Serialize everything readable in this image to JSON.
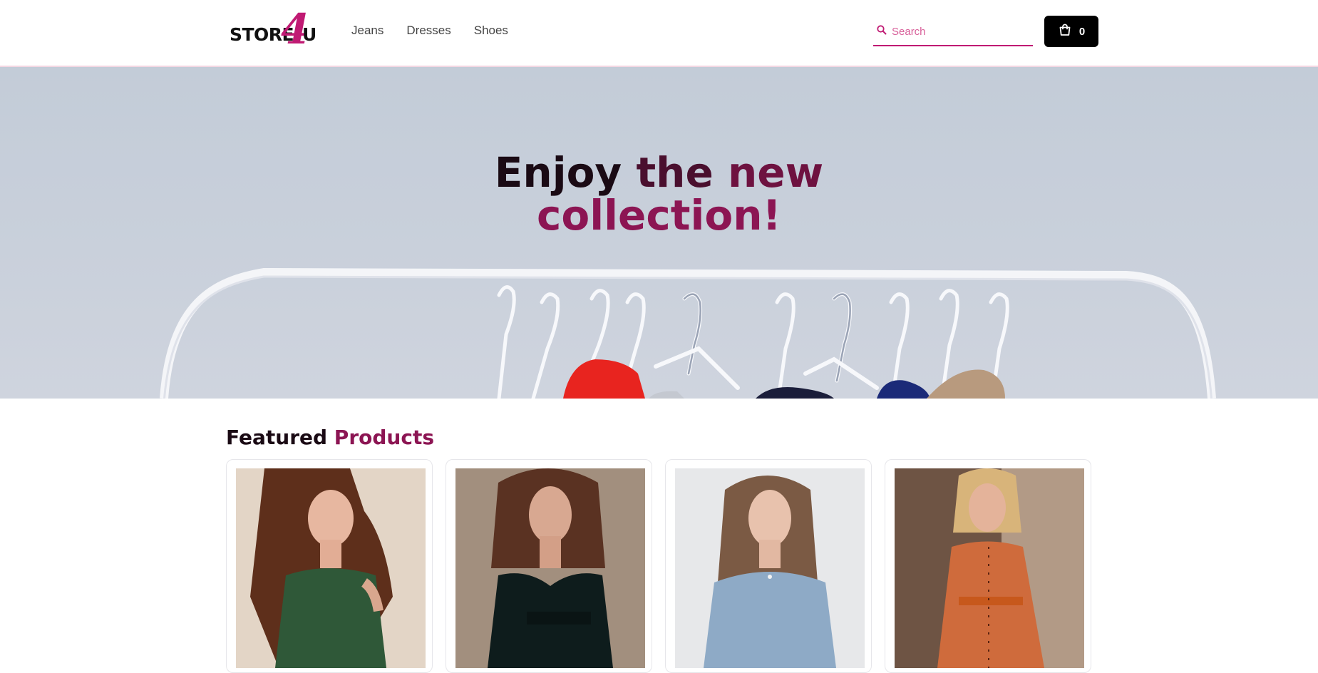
{
  "header": {
    "logo": {
      "text": "STORE",
      "four": "4",
      "u": "U"
    },
    "nav": [
      {
        "label": "Jeans"
      },
      {
        "label": "Dresses"
      },
      {
        "label": "Shoes"
      }
    ],
    "search": {
      "placeholder": "Search",
      "icon": "search-icon"
    },
    "cart": {
      "icon": "shopping-bag-icon",
      "count": "0"
    }
  },
  "hero": {
    "line1": {
      "word1": "Enjoy",
      "word2": "the",
      "word3": "new"
    },
    "line2": "collection!"
  },
  "featured": {
    "title_part1": "Featured",
    "title_part2": "Products",
    "products": [
      {
        "image": "model in green sleeveless dress"
      },
      {
        "image": "model in black long-sleeve dress"
      },
      {
        "image": "model in light blue dress"
      },
      {
        "image": "model in orange shirt dress with belt"
      }
    ]
  },
  "colors": {
    "accent": "#c01a73",
    "title_dark": "#1a0a14",
    "title_accent": "#8c1553",
    "cart_bg": "#000000"
  }
}
